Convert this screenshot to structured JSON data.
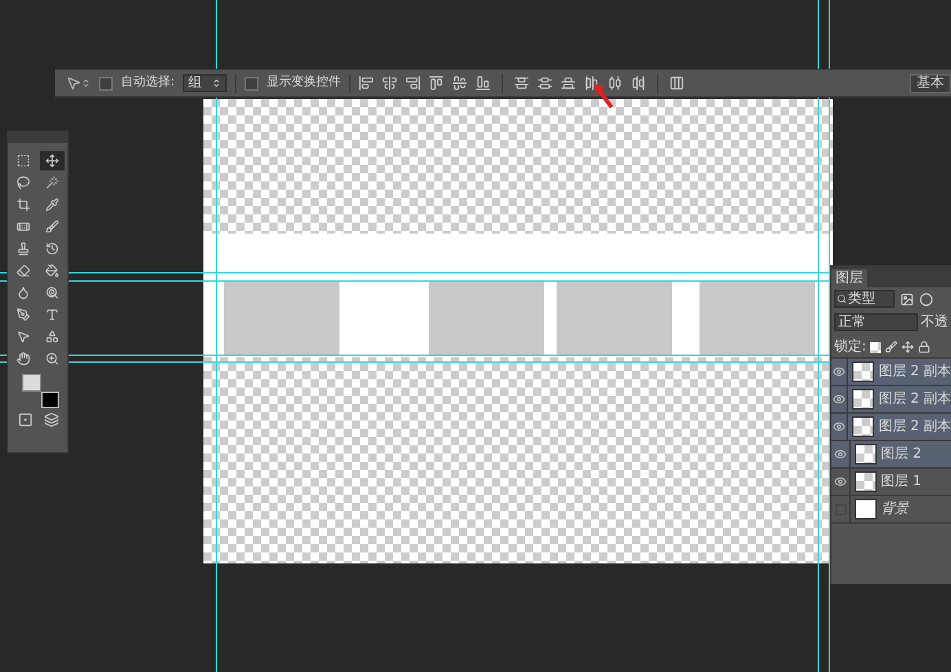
{
  "options_bar": {
    "auto_select": {
      "label": "自动选择:",
      "checked": false
    },
    "auto_select_target": "组",
    "show_transform": {
      "label": "显示变换控件",
      "checked": false
    },
    "workspace": "基本"
  },
  "toolbox": {
    "tools": [
      {
        "selected": false
      },
      {
        "selected": true
      },
      {
        "selected": false
      },
      {
        "selected": false
      },
      {
        "selected": false
      },
      {
        "selected": false
      },
      {
        "selected": false
      },
      {
        "selected": false
      },
      {
        "selected": false
      },
      {
        "selected": false
      },
      {
        "selected": false
      },
      {
        "selected": false
      },
      {
        "selected": false
      },
      {
        "selected": false
      },
      {
        "selected": false
      },
      {
        "selected": false
      },
      {
        "selected": false
      },
      {
        "selected": false
      },
      {
        "selected": false
      },
      {
        "selected": false
      }
    ]
  },
  "layers_panel": {
    "tab": "图层",
    "filter": "类型",
    "blend_mode": "正常",
    "opacity_label": "不透",
    "lock_label": "锁定:",
    "layers": [
      {
        "name": "图层 2 副本",
        "visible": true,
        "selected": true,
        "kind": "transparent"
      },
      {
        "name": "图层 2 副本",
        "visible": true,
        "selected": true,
        "kind": "transparent"
      },
      {
        "name": "图层 2 副本",
        "visible": true,
        "selected": true,
        "kind": "transparent"
      },
      {
        "name": "图层 2",
        "visible": true,
        "selected": true,
        "kind": "transparent"
      },
      {
        "name": "图层 1",
        "visible": true,
        "selected": false,
        "kind": "transparent"
      },
      {
        "name": "背景",
        "visible": false,
        "selected": false,
        "kind": "fill"
      }
    ]
  }
}
